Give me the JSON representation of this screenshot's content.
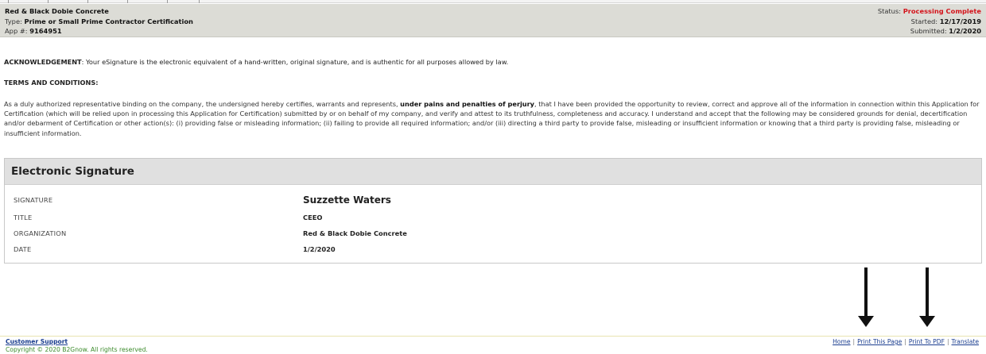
{
  "header": {
    "company": "Red & Black Dobie Concrete",
    "type_label": "Type:",
    "type_value": "Prime or Small Prime Contractor Certification",
    "app_label": "App #:",
    "app_value": "9164951",
    "status_label": "Status:",
    "status_value": "Processing Complete",
    "started_label": "Started:",
    "started_value": "12/17/2019",
    "submitted_label": "Submitted:",
    "submitted_value": "1/2/2020",
    "status_color": "#d4141b"
  },
  "acknowledgement": {
    "label": "ACKNOWLEDGEMENT",
    "text": ": Your eSignature is the electronic equivalent of a hand-written, original signature, and is authentic for all purposes allowed by law."
  },
  "terms": {
    "title": "TERMS AND CONDITIONS:",
    "part1": "As a duly authorized representative binding on the company, the undersigned hereby certifies, warrants and represents, ",
    "bold": "under pains and penalties of perjury",
    "part2": ", that I have been provided the opportunity to review, correct and approve all of the information in connection within this Application for Certification (which will be relied upon in processing this Application for Certification) submitted by or on behalf of my company, and verify and attest to its truthfulness, completeness and accuracy. I understand and accept that the following may be considered grounds for denial, decertification and/or debarment of Certification or other action(s): (i) providing false or misleading information; (ii) failing to provide all required information; and/or (iii) directing a third party to provide false, misleading or insufficient information or knowing that a third party is providing false, misleading or insufficient information."
  },
  "signature_panel": {
    "title": "Electronic Signature",
    "rows": [
      {
        "label": "SIGNATURE",
        "value": "Suzzette Waters"
      },
      {
        "label": "TITLE",
        "value": "CEEO"
      },
      {
        "label": "ORGANIZATION",
        "value": "Red & Black Dobie Concrete"
      },
      {
        "label": "DATE",
        "value": "1/2/2020"
      }
    ]
  },
  "footer": {
    "support_link": "Customer Support",
    "copyright": "Copyright © 2020 B2Gnow. All rights reserved.",
    "links": {
      "home": "Home",
      "print_page": "Print This Page",
      "print_pdf": "Print To PDF",
      "translate": "Translate",
      "separator": "|"
    }
  },
  "annotations": {
    "arrow_color": "#111111",
    "arrow_icon": "down-arrow-icon"
  }
}
